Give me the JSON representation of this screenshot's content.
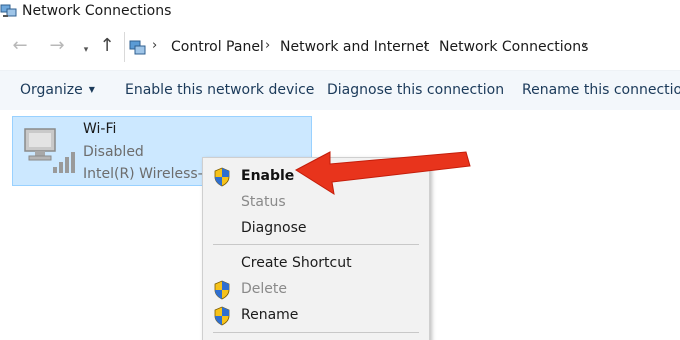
{
  "window": {
    "title": "Network Connections"
  },
  "address_bar": {
    "breadcrumbs": [
      "Control Panel",
      "Network and Internet",
      "Network Connections"
    ]
  },
  "toolbar": {
    "organize_label": "Organize",
    "enable_label": "Enable this network device",
    "diagnose_label": "Diagnose this connection",
    "rename_label": "Rename this connection"
  },
  "connection": {
    "name": "Wi-Fi",
    "status": "Disabled",
    "device": "Intel(R) Wireless-AC"
  },
  "context_menu": {
    "items": [
      {
        "label": "Enable",
        "icon": "uac-shield-icon",
        "state": "default"
      },
      {
        "label": "Status",
        "state": "disabled"
      },
      {
        "label": "Diagnose",
        "state": "enabled"
      },
      {
        "label": "Create Shortcut",
        "state": "enabled"
      },
      {
        "label": "Delete",
        "icon": "uac-shield-icon",
        "state": "disabled"
      },
      {
        "label": "Rename",
        "icon": "uac-shield-icon",
        "state": "enabled"
      }
    ]
  },
  "colors": {
    "selection_fill": "#cce8ff",
    "selection_border": "#99d1ff",
    "command_bar": "#f3f7fb",
    "menu_background": "#f2f2f2",
    "annotation_arrow": "#e8341c"
  }
}
